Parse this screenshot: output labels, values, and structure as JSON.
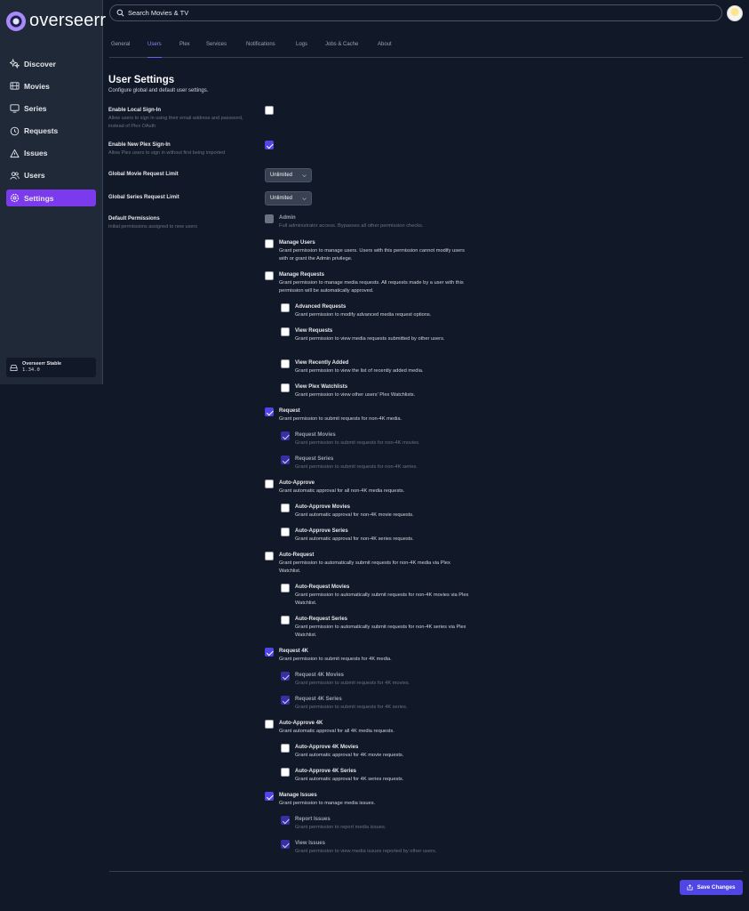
{
  "app": {
    "name": "overseerr"
  },
  "sidebar": {
    "items": [
      {
        "label": "Discover",
        "icon": "sparkles-icon"
      },
      {
        "label": "Movies",
        "icon": "film-icon"
      },
      {
        "label": "Series",
        "icon": "tv-icon"
      },
      {
        "label": "Requests",
        "icon": "clock-icon"
      },
      {
        "label": "Issues",
        "icon": "warning-icon"
      },
      {
        "label": "Users",
        "icon": "users-icon"
      },
      {
        "label": "Settings",
        "icon": "cog-icon",
        "active": true
      }
    ],
    "version": {
      "title": "Overseerr Stable",
      "number": "1.34.0"
    }
  },
  "search": {
    "placeholder": "Search Movies & TV"
  },
  "tabs": [
    "General",
    "Users",
    "Plex",
    "Services",
    "Notifications",
    "Logs",
    "Jobs & Cache",
    "About"
  ],
  "active_tab": "Users",
  "page": {
    "title": "User Settings",
    "subtitle": "Configure global and default user settings."
  },
  "settings": {
    "local_signin": {
      "label": "Enable Local Sign-In",
      "desc": "Allow users to sign in using their email address and password, instead of Plex OAuth",
      "checked": false
    },
    "plex_signin": {
      "label": "Enable New Plex Sign-In",
      "desc": "Allow Plex users to sign in without first being imported",
      "checked": true
    },
    "movie_limit": {
      "label": "Global Movie Request Limit",
      "value": "Unlimited"
    },
    "series_limit": {
      "label": "Global Series Request Limit",
      "value": "Unlimited"
    },
    "permissions": {
      "label": "Default Permissions",
      "desc": "Initial permissions assigned to new users"
    }
  },
  "permission_items": [
    {
      "title": "Admin",
      "desc": "Full administrator access. Bypasses all other permission checks.",
      "state": "disabled"
    },
    {
      "title": "Manage Users",
      "desc": "Grant permission to manage users. Users with this permission cannot modify users with or grant the Admin privilege.",
      "state": "off"
    },
    {
      "title": "Manage Requests",
      "desc": "Grant permission to manage media requests. All requests made by a user with this permission will be automatically approved.",
      "state": "off"
    },
    {
      "title": "Advanced Requests",
      "desc": "Grant permission to modify advanced media request options.",
      "state": "off"
    },
    {
      "title": "View Requests",
      "desc": "Grant permission to view media requests submitted by other users.",
      "state": "off"
    },
    {
      "title": "View Recently Added",
      "desc": "Grant permission to view the list of recently added media.",
      "state": "off"
    },
    {
      "title": "View Plex Watchlists",
      "desc": "Grant permission to view other users' Plex Watchlists.",
      "state": "off"
    },
    {
      "title": "Request",
      "desc": "Grant permission to submit requests for non-4K media.",
      "state": "on"
    },
    {
      "title": "Request Movies",
      "desc": "Grant permission to submit requests for non-4K movies.",
      "state": "on-dim"
    },
    {
      "title": "Request Series",
      "desc": "Grant permission to submit requests for non-4K series.",
      "state": "on-dim"
    },
    {
      "title": "Auto-Approve",
      "desc": "Grant automatic approval for all non-4K media requests.",
      "state": "off"
    },
    {
      "title": "Auto-Approve Movies",
      "desc": "Grant automatic approval for non-4K movie requests.",
      "state": "off"
    },
    {
      "title": "Auto-Approve Series",
      "desc": "Grant automatic approval for non-4K series requests.",
      "state": "off"
    },
    {
      "title": "Auto-Request",
      "desc": "Grant permission to automatically submit requests for non-4K media via Plex Watchlist.",
      "state": "off"
    },
    {
      "title": "Auto-Request Movies",
      "desc": "Grant permission to automatically submit requests for non-4K movies via Plex Watchlist.",
      "state": "off"
    },
    {
      "title": "Auto-Request Series",
      "desc": "Grant permission to automatically submit requests for non-4K series via Plex Watchlist.",
      "state": "off"
    },
    {
      "title": "Request 4K",
      "desc": "Grant permission to submit requests for 4K media.",
      "state": "on"
    },
    {
      "title": "Request 4K Movies",
      "desc": "Grant permission to submit requests for 4K movies.",
      "state": "on-dim"
    },
    {
      "title": "Request 4K Series",
      "desc": "Grant permission to submit requests for 4K series.",
      "state": "on-dim"
    },
    {
      "title": "Auto-Approve 4K",
      "desc": "Grant automatic approval for all 4K media requests.",
      "state": "off"
    },
    {
      "title": "Auto-Approve 4K Movies",
      "desc": "Grant automatic approval for 4K movie requests.",
      "state": "off"
    },
    {
      "title": "Auto-Approve 4K Series",
      "desc": "Grant automatic approval for 4K series requests.",
      "state": "off"
    },
    {
      "title": "Manage Issues",
      "desc": "Grant permission to manage media issues.",
      "state": "on"
    },
    {
      "title": "Report Issues",
      "desc": "Grant permission to report media issues.",
      "state": "on-dim"
    },
    {
      "title": "View Issues",
      "desc": "Grant permission to view media issues reported by other users.",
      "state": "on-dim"
    }
  ],
  "footer": {
    "save_label": "Save Changes"
  },
  "colors": {
    "accent": "#4f46e5",
    "active_nav": "#7c3aed",
    "background": "#111827",
    "sidebar": "#1f2937"
  }
}
